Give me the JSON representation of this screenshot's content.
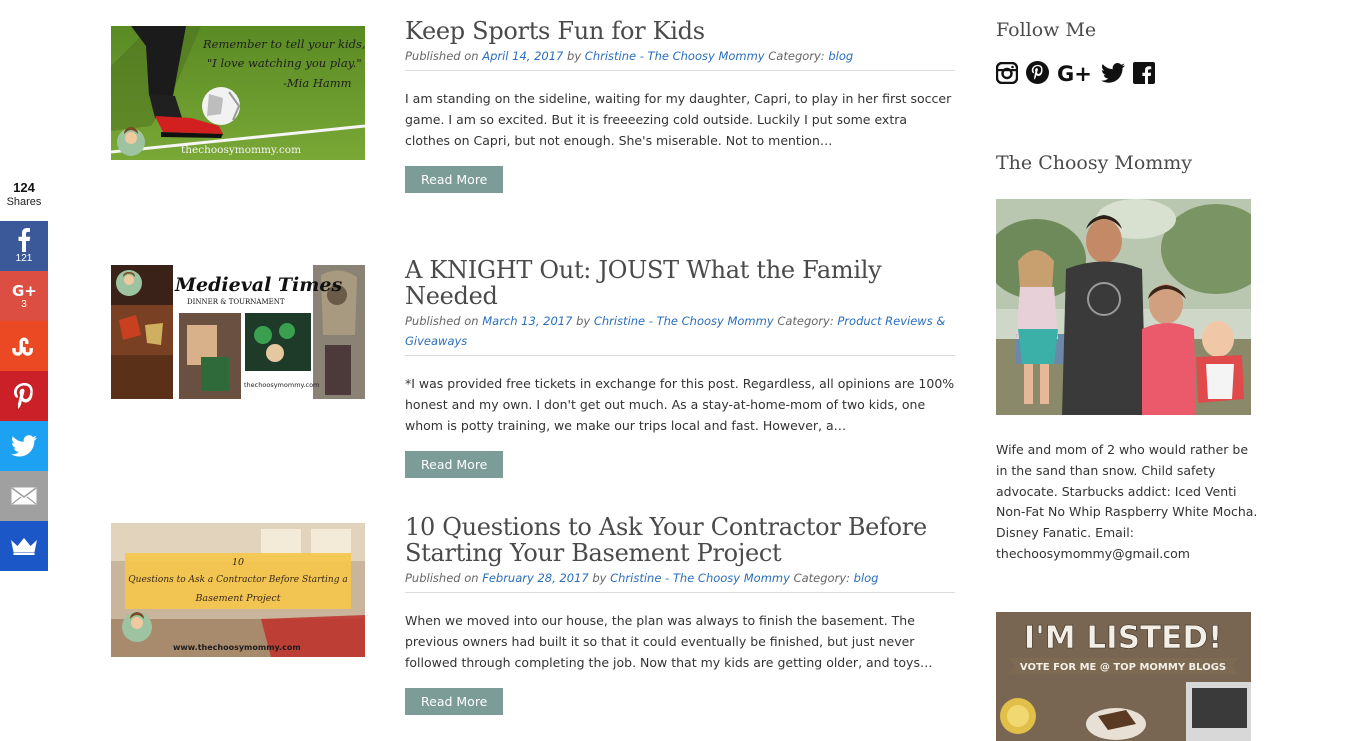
{
  "share": {
    "total": "124",
    "total_label": "Shares",
    "facebook_count": "121",
    "gplus_count": "3",
    "colors": {
      "facebook": "#3b5998",
      "gplus": "#dc4e41",
      "stumbleupon": "#eb4924",
      "pinterest": "#cb2027",
      "twitter": "#1da1f2",
      "email": "#a0a0a0",
      "sumome": "#1c57c7"
    }
  },
  "posts": [
    {
      "title": "Keep Sports Fun for Kids",
      "published_prefix": "Published on",
      "date": "April 14, 2017",
      "by": "by",
      "author": "Christine - The Choosy Mommy",
      "category_label": "Category:",
      "category": "blog",
      "excerpt": "I am standing on the sideline, waiting for my daughter, Capri, to play in her first soccer game. I am so excited. But it is freeeezing cold outside. Luckily I put some extra clothes on Capri, but not enough. She's miserable. Not to mention…",
      "read_more": "Read More",
      "thumb": {
        "quote_line1": "Remember to tell your kids,",
        "quote_line2": "\"I love watching you play.\"",
        "quote_line3": "-Mia Hamm",
        "site": "thechoosymommy.com"
      }
    },
    {
      "title": "A KNIGHT Out: JOUST What the Family Needed",
      "published_prefix": "Published on",
      "date": "March 13, 2017",
      "by": "by",
      "author": "Christine - The Choosy Mommy",
      "category_label": "Category:",
      "category": "Product Reviews & Giveaways",
      "excerpt": "*I was provided free tickets in exchange for this post. Regardless, all opinions are 100% honest and my own. I don't get out much. As a stay-at-home-mom of two kids, one whom is potty training, we make our trips local and fast. However, a…",
      "read_more": "Read More",
      "thumb": {
        "logo_line1": "Medieval Times",
        "logo_line2": "DINNER & TOURNAMENT",
        "site": "thechoosymommy.com"
      }
    },
    {
      "title": "10 Questions to Ask Your Contractor Before Starting Your Basement Project",
      "published_prefix": "Published on",
      "date": "February 28, 2017",
      "by": "by",
      "author": "Christine - The Choosy Mommy",
      "category_label": "Category:",
      "category": "blog",
      "excerpt": "When we moved into our house, the plan was always to finish the basement. The previous owners had built it so that it could eventually be finished, but just never followed through completing the job. Now that my kids are getting older, and toys…",
      "read_more": "Read More",
      "thumb": {
        "line1": "10",
        "line2": "Questions to Ask a Contractor Before Starting a",
        "line3": "Basement Project",
        "site": "www.thechoosymommy.com"
      }
    }
  ],
  "sidebar": {
    "follow_title": "Follow Me",
    "follow_icons": [
      "instagram-icon",
      "pinterest-icon",
      "google-plus-icon",
      "twitter-icon",
      "facebook-icon"
    ],
    "gplus_text": "G+",
    "about_title": "The Choosy Mommy",
    "bio": "Wife and mom of 2 who would rather be in the sand than snow. Child safety advocate. Starbucks addict: Iced Venti Non-Fat No Whip Raspberry White Mocha. Disney Fanatic. Email: thechoosymommy@gmail.com",
    "listed_title": "I'M LISTED!",
    "listed_sub": "VOTE FOR ME @ TOP MOMMY BLOGS"
  }
}
